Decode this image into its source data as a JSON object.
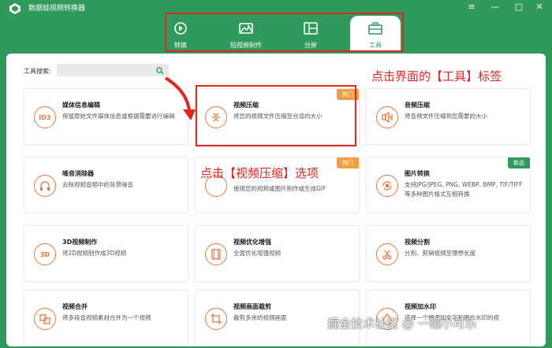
{
  "window": {
    "title": "数据蛙视频转换器",
    "controls": [
      "≡",
      "—",
      "□",
      "✕"
    ]
  },
  "nav": {
    "tabs": [
      {
        "label": "转换",
        "icon": "convert-icon",
        "active": false
      },
      {
        "label": "短视频制作",
        "icon": "image-icon",
        "active": false
      },
      {
        "label": "分屏",
        "icon": "split-screen-icon",
        "active": false
      },
      {
        "label": "工具",
        "icon": "toolbox-icon",
        "active": true
      }
    ]
  },
  "search": {
    "label": "工具搜索:",
    "value": "",
    "placeholder": ""
  },
  "annotations": {
    "tools_tab": "点击界面的【工具】标签",
    "compress_option": "点击【视频压缩】选项"
  },
  "cards": [
    {
      "title": "媒体信息编辑",
      "desc": "保留原始文件媒体信息或根据需要进行编辑",
      "icon": "id3-icon",
      "icon_text": "ID3",
      "badge": ""
    },
    {
      "title": "视频压缩",
      "desc": "将您的视频文件压缩至合适的大小",
      "icon": "compress-icon",
      "icon_text": "",
      "badge": "热门"
    },
    {
      "title": "音频压缩",
      "desc": "将音频文件压缩到您需要的大小",
      "icon": "audio-compress-icon",
      "icon_text": "",
      "badge": ""
    },
    {
      "title": "噪音消除器",
      "desc": "去除视频音频中的背景噪音",
      "icon": "headphones-icon",
      "icon_text": "",
      "badge": ""
    },
    {
      "title": "",
      "desc": "使用您的视频或图片制作或生成GIF",
      "icon": "gif-icon",
      "icon_text": "",
      "badge": "热门"
    },
    {
      "title": "图片转换",
      "desc": "支持JPG/JPEG, PNG, WEBP, BMP, TIF/TIFF等多种图片格式互相转换",
      "icon": "image-convert-icon",
      "icon_text": "",
      "badge": "新品"
    },
    {
      "title": "3D视频制作",
      "desc": "将2D视频制作成3D视频",
      "icon": "3d-icon",
      "icon_text": "3D",
      "badge": ""
    },
    {
      "title": "视频优化增强",
      "desc": "全面优化增强视频",
      "icon": "film-enhance-icon",
      "icon_text": "",
      "badge": ""
    },
    {
      "title": "视频分割",
      "desc": "分割、剪辑视频至理想长度",
      "icon": "scissors-icon",
      "icon_text": "",
      "badge": ""
    },
    {
      "title": "视频合并",
      "desc": "将多段音视频素材合并为一个视频",
      "icon": "merge-icon",
      "icon_text": "",
      "badge": ""
    },
    {
      "title": "视频画面裁剪",
      "desc": "裁剪多余的视频画面",
      "icon": "crop-icon",
      "icon_text": "",
      "badge": ""
    },
    {
      "title": "视频加水印",
      "desc": "选择一个想添加文字和图片水印的视",
      "icon": "watermark-drop-icon",
      "icon_text": "",
      "badge": ""
    }
  ],
  "watermark": "掘金技术社区 @ 一罐小可乐",
  "colors": {
    "brand_green": "#2f9a5b",
    "accent_orange": "#e8773d",
    "hot_badge": "#f0a043",
    "annotation_red": "#e0261f"
  }
}
